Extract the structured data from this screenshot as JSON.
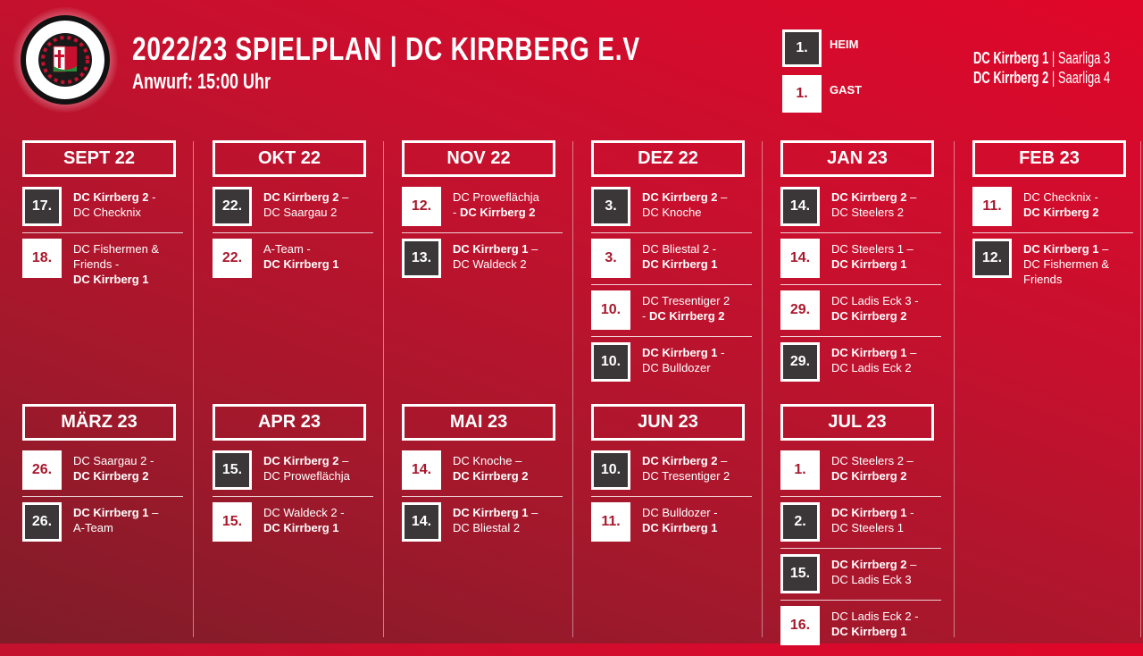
{
  "header": {
    "title": "2022/23 SPIELPLAN | DC KIRRBERG E.V",
    "subtitle": "Anwurf: 15:00 Uhr",
    "logo_text": "DC KIRRBERG e.V. – DIE STERNE VOM TUSSBERCH"
  },
  "legend": {
    "home": {
      "num": "1.",
      "label": "HEIM"
    },
    "away": {
      "num": "1.",
      "label": "GAST"
    }
  },
  "teams": [
    {
      "name": "DC Kirrberg 1",
      "league": "| Saarliga 3"
    },
    {
      "name": "DC Kirrberg 2",
      "league": "| Saarliga 4"
    }
  ],
  "colors": {
    "home_box": "#3b3637",
    "away_box": "#ffffff",
    "away_text": "#a8182c",
    "bg": "#c8102e"
  },
  "months": [
    {
      "label": "SEPT 22",
      "matches": [
        {
          "day": "17.",
          "home": true,
          "lines": [
            [
              {
                "t": "DC Kirrberg 2",
                "b": true
              },
              {
                "t": " -"
              }
            ],
            [
              {
                "t": "DC Checknix"
              }
            ]
          ]
        },
        {
          "day": "18.",
          "home": false,
          "lines": [
            [
              {
                "t": "DC Fishermen &"
              }
            ],
            [
              {
                "t": "Friends -"
              }
            ],
            [
              {
                "t": "DC Kirrberg 1",
                "b": true
              }
            ]
          ]
        }
      ]
    },
    {
      "label": "OKT 22",
      "matches": [
        {
          "day": "22.",
          "home": true,
          "lines": [
            [
              {
                "t": "DC Kirrberg 2",
                "b": true
              },
              {
                "t": " –"
              }
            ],
            [
              {
                "t": "DC Saargau 2"
              }
            ]
          ]
        },
        {
          "day": "22.",
          "home": false,
          "lines": [
            [
              {
                "t": "A-Team -"
              }
            ],
            [
              {
                "t": "DC Kirrberg 1",
                "b": true
              }
            ]
          ]
        }
      ]
    },
    {
      "label": "NOV 22",
      "matches": [
        {
          "day": "12.",
          "home": false,
          "lines": [
            [
              {
                "t": "DC Proweflächja"
              }
            ],
            [
              {
                "t": "- "
              },
              {
                "t": "DC Kirrberg 2",
                "b": true
              }
            ]
          ]
        },
        {
          "day": "13.",
          "home": true,
          "lines": [
            [
              {
                "t": "DC Kirrberg 1",
                "b": true
              },
              {
                "t": " –"
              }
            ],
            [
              {
                "t": "DC Waldeck 2"
              }
            ]
          ]
        }
      ]
    },
    {
      "label": "DEZ 22",
      "matches": [
        {
          "day": "3.",
          "home": true,
          "lines": [
            [
              {
                "t": "DC Kirrberg 2",
                "b": true
              },
              {
                "t": " –"
              }
            ],
            [
              {
                "t": "DC Knoche"
              }
            ]
          ]
        },
        {
          "day": "3.",
          "home": false,
          "lines": [
            [
              {
                "t": "DC Bliestal 2 -"
              }
            ],
            [
              {
                "t": "DC Kirrberg 1",
                "b": true
              }
            ]
          ]
        },
        {
          "day": "10.",
          "home": false,
          "lines": [
            [
              {
                "t": "DC Tresentiger 2"
              }
            ],
            [
              {
                "t": "- "
              },
              {
                "t": "DC Kirrberg 2",
                "b": true
              }
            ]
          ]
        },
        {
          "day": "10.",
          "home": true,
          "lines": [
            [
              {
                "t": "DC Kirrberg 1",
                "b": true
              },
              {
                "t": " -"
              }
            ],
            [
              {
                "t": "DC Bulldozer"
              }
            ]
          ]
        }
      ]
    },
    {
      "label": "JAN 23",
      "matches": [
        {
          "day": "14.",
          "home": true,
          "lines": [
            [
              {
                "t": "DC Kirrberg 2",
                "b": true
              },
              {
                "t": " –"
              }
            ],
            [
              {
                "t": "DC Steelers 2"
              }
            ]
          ]
        },
        {
          "day": "14.",
          "home": false,
          "lines": [
            [
              {
                "t": "DC Steelers 1 –"
              }
            ],
            [
              {
                "t": "DC Kirrberg 1",
                "b": true
              }
            ]
          ]
        },
        {
          "day": "29.",
          "home": false,
          "lines": [
            [
              {
                "t": "DC Ladis Eck 3 -"
              }
            ],
            [
              {
                "t": "DC Kirrberg 2",
                "b": true
              }
            ]
          ]
        },
        {
          "day": "29.",
          "home": true,
          "lines": [
            [
              {
                "t": "DC Kirrberg 1",
                "b": true
              },
              {
                "t": " –"
              }
            ],
            [
              {
                "t": "DC Ladis Eck 2"
              }
            ]
          ]
        }
      ]
    },
    {
      "label": "FEB 23",
      "matches": [
        {
          "day": "11.",
          "home": false,
          "lines": [
            [
              {
                "t": "DC Checknix -"
              }
            ],
            [
              {
                "t": "DC Kirrberg 2",
                "b": true
              }
            ]
          ]
        },
        {
          "day": "12.",
          "home": true,
          "lines": [
            [
              {
                "t": "DC Kirrberg 1",
                "b": true
              },
              {
                "t": " –"
              }
            ],
            [
              {
                "t": "DC Fishermen &"
              }
            ],
            [
              {
                "t": "Friends"
              }
            ]
          ]
        }
      ]
    },
    {
      "label": "MÄRZ 23",
      "matches": [
        {
          "day": "26.",
          "home": false,
          "lines": [
            [
              {
                "t": "DC Saargau 2 -"
              }
            ],
            [
              {
                "t": "DC Kirrberg 2",
                "b": true
              }
            ]
          ]
        },
        {
          "day": "26.",
          "home": true,
          "lines": [
            [
              {
                "t": "DC Kirrberg 1",
                "b": true
              },
              {
                "t": " –"
              }
            ],
            [
              {
                "t": "A-Team"
              }
            ]
          ]
        }
      ]
    },
    {
      "label": "APR 23",
      "matches": [
        {
          "day": "15.",
          "home": true,
          "lines": [
            [
              {
                "t": "DC Kirrberg 2",
                "b": true
              },
              {
                "t": " –"
              }
            ],
            [
              {
                "t": "DC Proweflächja"
              }
            ]
          ]
        },
        {
          "day": "15.",
          "home": false,
          "lines": [
            [
              {
                "t": "DC Waldeck 2 -"
              }
            ],
            [
              {
                "t": "DC Kirrberg 1",
                "b": true
              }
            ]
          ]
        }
      ]
    },
    {
      "label": "MAI 23",
      "matches": [
        {
          "day": "14.",
          "home": false,
          "lines": [
            [
              {
                "t": "DC Knoche –"
              }
            ],
            [
              {
                "t": "DC Kirrberg 2",
                "b": true
              }
            ]
          ]
        },
        {
          "day": "14.",
          "home": true,
          "lines": [
            [
              {
                "t": "DC Kirrberg 1",
                "b": true
              },
              {
                "t": " –"
              }
            ],
            [
              {
                "t": "DC Bliestal 2"
              }
            ]
          ]
        }
      ]
    },
    {
      "label": "JUN 23",
      "matches": [
        {
          "day": "10.",
          "home": true,
          "lines": [
            [
              {
                "t": "DC Kirrberg 2",
                "b": true
              },
              {
                "t": " –"
              }
            ],
            [
              {
                "t": "DC Tresentiger 2"
              }
            ]
          ]
        },
        {
          "day": "11.",
          "home": false,
          "lines": [
            [
              {
                "t": "DC Bulldozer -"
              }
            ],
            [
              {
                "t": "DC Kirrberg 1",
                "b": true
              }
            ]
          ]
        }
      ]
    },
    {
      "label": "JUL 23",
      "matches": [
        {
          "day": "1.",
          "home": false,
          "lines": [
            [
              {
                "t": "DC Steelers 2 –"
              }
            ],
            [
              {
                "t": "DC Kirrberg 2",
                "b": true
              }
            ]
          ]
        },
        {
          "day": "2.",
          "home": true,
          "lines": [
            [
              {
                "t": "DC Kirrberg 1",
                "b": true
              },
              {
                "t": " -"
              }
            ],
            [
              {
                "t": "DC Steelers 1"
              }
            ]
          ]
        },
        {
          "day": "15.",
          "home": true,
          "lines": [
            [
              {
                "t": "DC Kirrberg 2",
                "b": true
              },
              {
                "t": " –"
              }
            ],
            [
              {
                "t": "DC Ladis Eck 3"
              }
            ]
          ]
        },
        {
          "day": "16.",
          "home": false,
          "lines": [
            [
              {
                "t": "DC Ladis Eck 2 -"
              }
            ],
            [
              {
                "t": "DC Kirrberg 1",
                "b": true
              }
            ]
          ]
        }
      ]
    }
  ]
}
